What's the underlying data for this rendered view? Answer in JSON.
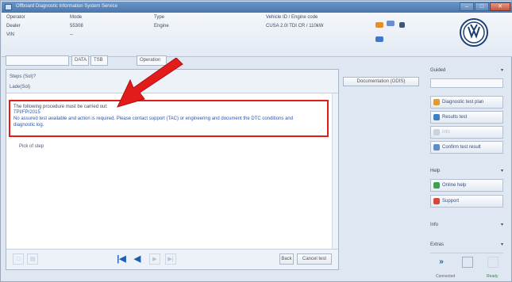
{
  "window": {
    "title": "Offboard Diagnostic Information System Service",
    "controls": {
      "minimize": "–",
      "maximize": "□",
      "close": "✕"
    }
  },
  "header": {
    "col1": {
      "label1": "Operator",
      "label2": "Dealer",
      "label3": "VIN"
    },
    "col2": {
      "label1": "Mode",
      "value1": "55308",
      "value2": "--"
    },
    "col3": {
      "label1": "Type",
      "value1": "Engine"
    },
    "col4": {
      "label1": "Vehicle ID / Engine code",
      "value1": "CUSA 2.0l TDI CR / 110kW"
    }
  },
  "toolbar": {
    "search_value": "",
    "field1": "DATA",
    "field2": "TSB",
    "operation_label": "Operation"
  },
  "main": {
    "caption": "Steps (Sol)?",
    "subcaption": "Lade(Sol)",
    "messages": {
      "line1": "The following procedure must be carried out:",
      "line2": "TPI/FP/2015",
      "line3": "No assured test available and action is required. Please contact support (TAC) or engineering and document the DTC conditions and",
      "line4": "diagnostic log."
    },
    "pick_text": "Pick of step",
    "bottom": {
      "first_icon": "skip-first-icon",
      "prev_icon": "previous-icon",
      "back_label": "Back",
      "continue_label": "Cancel test"
    }
  },
  "center_button": "Documentation (ODIS)",
  "right_panel": {
    "section1_title": "Guided",
    "section1_input": "",
    "buttons1": [
      {
        "label": "Diagnostic test plan",
        "icon": "diagnostic-plan-icon",
        "disabled": false
      },
      {
        "label": "Results test",
        "icon": "results-icon",
        "disabled": false
      },
      {
        "label": "Info",
        "icon": "info-icon",
        "disabled": true
      },
      {
        "label": "Confirm test result",
        "icon": "confirm-icon",
        "disabled": false
      }
    ],
    "section2_title": "Help",
    "buttons2": [
      {
        "label": "Online help",
        "icon": "online-help-icon"
      },
      {
        "label": "Support",
        "icon": "support-icon"
      }
    ],
    "section3_title": "Info",
    "section4_title": "Extras",
    "status": "Connected",
    "status2": "Ready"
  },
  "colors": {
    "highlight_border": "#e21b1b",
    "arrow": "#e21b1b",
    "brand_blue": "#1d3f73",
    "link_blue": "#2d56b0"
  }
}
